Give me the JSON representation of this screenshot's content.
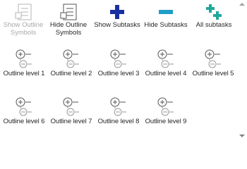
{
  "ribbon": {
    "top_buttons": [
      {
        "label": "Show Outline\nSymbols",
        "icon": "show-outline-symbols-icon",
        "disabled": true
      },
      {
        "label": "Hide Outline\nSymbols",
        "icon": "hide-outline-symbols-icon",
        "disabled": false
      },
      {
        "label": "Show Subtasks",
        "icon": "plus-icon",
        "disabled": false
      },
      {
        "label": "Hide Subtasks",
        "icon": "minus-icon",
        "disabled": false
      },
      {
        "label": "All subtasks",
        "icon": "all-subtasks-icon",
        "disabled": false
      }
    ],
    "outline_levels": [
      {
        "label": "Outline level 1"
      },
      {
        "label": "Outline level 2"
      },
      {
        "label": "Outline level 3"
      },
      {
        "label": "Outline level 4"
      },
      {
        "label": "Outline level 5"
      },
      {
        "label": "Outline level 6"
      },
      {
        "label": "Outline level 7"
      },
      {
        "label": "Outline level 8"
      },
      {
        "label": "Outline level 9"
      }
    ]
  },
  "colors": {
    "plus": "#1a2fa0",
    "minus": "#1e9ec7",
    "all_subtasks": "#1fa89a",
    "disabled": "#b4b4b4",
    "outline_icon": "#555555"
  }
}
